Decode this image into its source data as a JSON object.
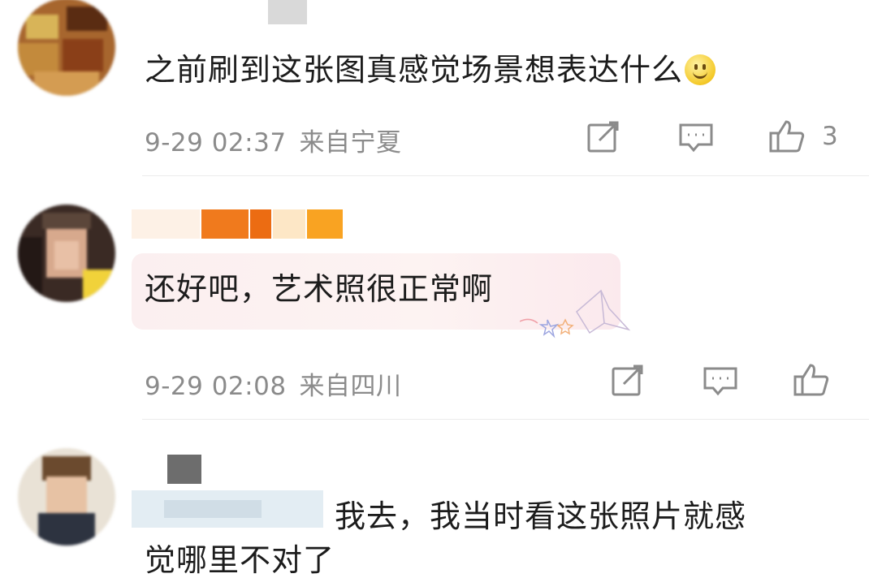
{
  "comments": [
    {
      "text": "之前刷到这张图真感觉场景想表达什么",
      "emoji": "smiley-face",
      "time": "9-29 02:37",
      "source": "来自宁夏",
      "likes": "3"
    },
    {
      "text": "还好吧，艺术照很正常啊",
      "time": "9-29 02:08",
      "source": "来自四川"
    },
    {
      "text": "我去，我当时看这张照片就感",
      "text_line2": "觉哪里不对了"
    }
  ],
  "colors": {
    "meta_gray": "#8b8b8b",
    "divider": "#ececec",
    "bubble_pink": "#fbeff0",
    "name_orange": "#f07a1d"
  },
  "icons": [
    "share-icon",
    "comment-icon",
    "like-icon",
    "smiley-emoji",
    "paper-crane-sticker"
  ]
}
